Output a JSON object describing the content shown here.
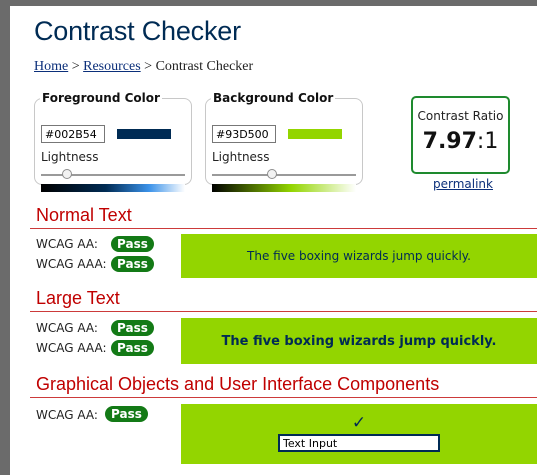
{
  "page": {
    "title": "Contrast Checker",
    "breadcrumb": {
      "home": "Home",
      "sep1": ">",
      "resources": "Resources",
      "sep2": ">",
      "current": "Contrast Checker"
    }
  },
  "foreground": {
    "legend": "Foreground Color",
    "hex": "#002B54",
    "swatch_color": "#002B54",
    "lightness_label": "Lightness",
    "lightness_value": 0.18
  },
  "background": {
    "legend": "Background Color",
    "hex": "#93D500",
    "swatch_color": "#93D500",
    "lightness_label": "Lightness",
    "lightness_value": 0.42
  },
  "ratio": {
    "label": "Contrast Ratio",
    "value": "7.97",
    "suffix": ":1",
    "permalink": "permalink"
  },
  "sections": {
    "normal": {
      "title": "Normal Text",
      "aa_label": "WCAG AA:",
      "aa_result": "Pass",
      "aaa_label": "WCAG AAA:",
      "aaa_result": "Pass",
      "sample": "The five boxing wizards jump quickly."
    },
    "large": {
      "title": "Large Text",
      "aa_label": "WCAG AA:",
      "aa_result": "Pass",
      "aaa_label": "WCAG AAA:",
      "aaa_result": "Pass",
      "sample": "The five boxing wizards jump quickly."
    },
    "graphical": {
      "title": "Graphical Objects and User Interface Components",
      "aa_label": "WCAG AA:",
      "aa_result": "Pass",
      "checkmark": "✓",
      "input_value": "Text Input"
    }
  },
  "colors": {
    "title": "#002B54",
    "section_heading": "#C00000",
    "pass_badge": "#137A16",
    "ratio_border": "#1E8A2E"
  }
}
